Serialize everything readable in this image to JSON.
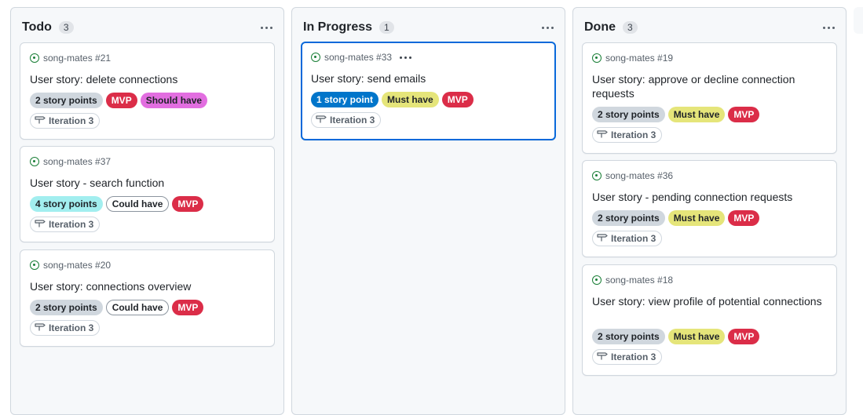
{
  "colors": {
    "open_icon": "#1a7f37",
    "selected_border": "#0969da",
    "label_gray": "#d0d7de",
    "label_mvp": "#db2d48",
    "label_should": "#e26ee0",
    "label_cyan": "#a2eeef",
    "label_blue": "#0075ca",
    "label_must": "#e5e57a"
  },
  "columns": [
    {
      "title": "Todo",
      "count": "3",
      "cards": [
        {
          "meta": "song-mates #21",
          "title": "User story: delete connections",
          "labels": [
            "2 story points",
            "MVP",
            "Should have"
          ],
          "iteration": "Iteration 3"
        },
        {
          "meta": "song-mates #37",
          "title": "User story - search function",
          "labels": [
            "4 story points",
            "Could have",
            "MVP"
          ],
          "iteration": "Iteration 3"
        },
        {
          "meta": "song-mates #20",
          "title": "User story: connections overview",
          "labels": [
            "2 story points",
            "Could have",
            "MVP"
          ],
          "iteration": "Iteration 3"
        }
      ]
    },
    {
      "title": "In Progress",
      "count": "1",
      "cards": [
        {
          "meta": "song-mates #33",
          "title": "User story: send emails",
          "labels": [
            "1 story point",
            "Must have",
            "MVP"
          ],
          "iteration": "Iteration 3"
        }
      ]
    },
    {
      "title": "Done",
      "count": "3",
      "cards": [
        {
          "meta": "song-mates #19",
          "title": "User story: approve or decline connection requests",
          "labels": [
            "2 story points",
            "Must have",
            "MVP"
          ],
          "iteration": "Iteration 3"
        },
        {
          "meta": "song-mates #36",
          "title": "User story - pending connection requests",
          "labels": [
            "2 story points",
            "Must have",
            "MVP"
          ],
          "iteration": "Iteration 3"
        },
        {
          "meta": "song-mates #18",
          "title": "User story: view profile of potential connections",
          "labels": [
            "2 story points",
            "Must have",
            "MVP"
          ],
          "iteration": "Iteration 3"
        }
      ]
    }
  ]
}
